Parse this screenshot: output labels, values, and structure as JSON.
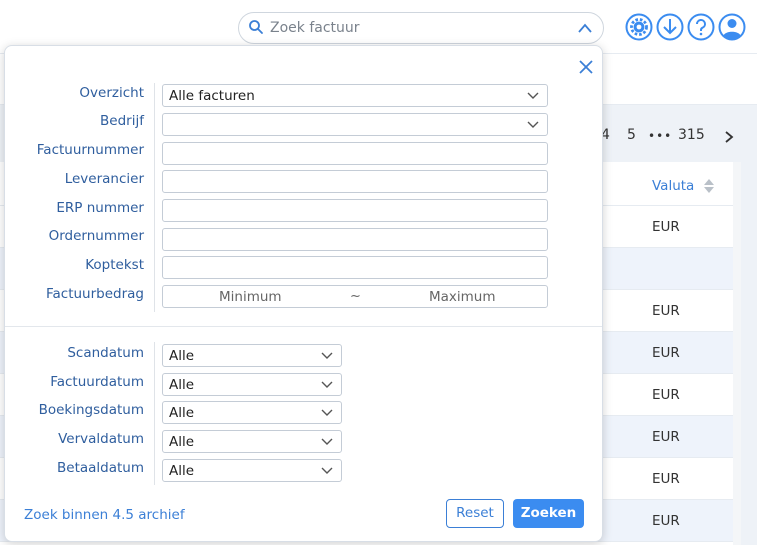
{
  "search": {
    "placeholder": "Zoek factuur"
  },
  "toolbar_icons": [
    "gear-icon",
    "download-icon",
    "help-icon",
    "user-icon"
  ],
  "pager": {
    "page_partial": "4",
    "page_next": "5",
    "ellipsis": "•••",
    "last_page": "315"
  },
  "table": {
    "column_valuta": "Valuta",
    "rows": [
      "EUR",
      "",
      "EUR",
      "EUR",
      "EUR",
      "EUR",
      "EUR",
      "EUR"
    ]
  },
  "filters": {
    "overzicht": {
      "label": "Overzicht",
      "value": "Alle facturen"
    },
    "bedrijf": {
      "label": "Bedrijf",
      "value": ""
    },
    "factuurnummer": {
      "label": "Factuurnummer",
      "value": ""
    },
    "leverancier": {
      "label": "Leverancier",
      "value": ""
    },
    "erp_nummer": {
      "label": "ERP nummer",
      "value": ""
    },
    "ordernummer": {
      "label": "Ordernummer",
      "value": ""
    },
    "koptekst": {
      "label": "Koptekst",
      "value": ""
    },
    "factuurbedrag": {
      "label": "Factuurbedrag",
      "min_placeholder": "Minimum",
      "separator": "~",
      "max_placeholder": "Maximum"
    }
  },
  "dates": [
    {
      "label": "Scandatum",
      "value": "Alle"
    },
    {
      "label": "Factuurdatum",
      "value": "Alle"
    },
    {
      "label": "Boekingsdatum",
      "value": "Alle"
    },
    {
      "label": "Vervaldatum",
      "value": "Alle"
    },
    {
      "label": "Betaaldatum",
      "value": "Alle"
    }
  ],
  "footer": {
    "archive_link": "Zoek binnen 4.5 archief",
    "reset_label": "Reset",
    "search_label": "Zoeken"
  },
  "colors": {
    "accent": "#3b8cf0",
    "label": "#2f5e9e",
    "link": "#3b7fd6"
  }
}
